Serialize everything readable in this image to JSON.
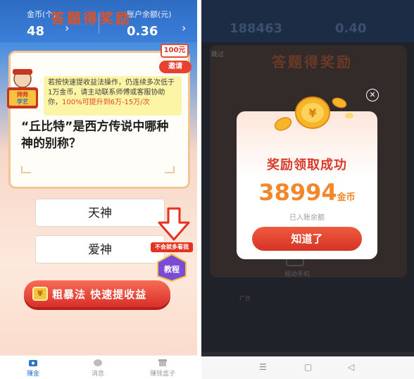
{
  "left": {
    "stats": {
      "coins_label": "金币(个)",
      "coins_value": "48",
      "balance_label": "账户余额(元)",
      "balance_value": "0.36"
    },
    "card": {
      "title": "答题得奖励",
      "hundred_badge": "100元",
      "invite_label": "邀请",
      "notice_part1": "若按快速提收益法操作，仍连续多次低于1万金币，请主动联系师傅或客服协助你，",
      "notice_highlight": "100%可提升到6万-15万/次",
      "mascot_text": "拜师学艺",
      "question": "“丘比特”是西方传说中哪种神的别称？"
    },
    "answers": [
      "天神",
      "爱神"
    ],
    "tutorial": {
      "tag": "不会就多看我",
      "badge": "教程"
    },
    "cta": {
      "coin_symbol": "¥",
      "label": "粗暴法 快速提收益"
    },
    "tabbar": [
      {
        "label": "赚金",
        "active": true
      },
      {
        "label": "消息",
        "active": false
      },
      {
        "label": "赚钱盒子",
        "active": false
      }
    ]
  },
  "right": {
    "bg": {
      "coins_value": "188463",
      "balance_value": "0.40",
      "skip_label": "跳过",
      "title": "答题得奖励"
    },
    "modal": {
      "close_symbol": "✕",
      "title": "奖励领取成功",
      "amount": "38994",
      "unit": "金币",
      "sub": "已入账余额",
      "button": "知道了"
    },
    "ad": {
      "text": "摇动手机",
      "tag": "广告"
    },
    "navbar": {
      "menu": "☰",
      "home": "▢",
      "back": "◁"
    }
  },
  "colors": {
    "primary_blue": "#2f73c9",
    "accent_red": "#e8412f",
    "amount_orange": "#f2872c"
  }
}
